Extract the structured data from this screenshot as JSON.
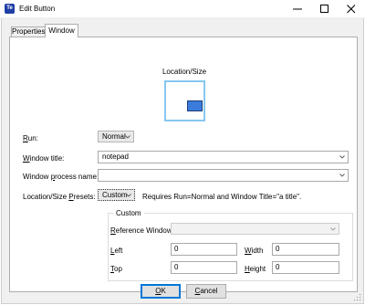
{
  "window": {
    "title": "Edit Button",
    "app_icon_glyph": "Te",
    "controls": [
      "minimize-icon",
      "maximize-icon",
      "close-icon"
    ]
  },
  "tabs": [
    {
      "label": "Properties",
      "active": false
    },
    {
      "label": "Window",
      "active": true
    }
  ],
  "preview": {
    "label": "Location/Size"
  },
  "form": {
    "run": {
      "label_pre": "",
      "label_u": "R",
      "label_post": "un:",
      "value": "Normal"
    },
    "window_title": {
      "label_pre": "",
      "label_u": "W",
      "label_post": "indow title:",
      "value": "notepad"
    },
    "process_name": {
      "label_pre": "Window ",
      "label_u": "p",
      "label_post": "rocess name:",
      "value": ""
    },
    "presets": {
      "label_pre": "Location/Size ",
      "label_u": "P",
      "label_post": "resets:",
      "value": "Custom",
      "note": "Requires Run=Normal and Window Title=\"a title\"."
    }
  },
  "custom": {
    "title": "Custom",
    "reference_window": {
      "label_pre": "",
      "label_u": "R",
      "label_post": "eference Window:",
      "value": ""
    },
    "left": {
      "label_pre": "",
      "label_u": "L",
      "label_post": "eft",
      "value": "0"
    },
    "width": {
      "label_pre": "",
      "label_u": "W",
      "label_post": "idth",
      "value": "0"
    },
    "top": {
      "label_pre": "",
      "label_u": "T",
      "label_post": "op",
      "value": "0"
    },
    "height": {
      "label_pre": "",
      "label_u": "H",
      "label_post": "eight",
      "value": "0"
    }
  },
  "buttons": {
    "ok": {
      "label_u": "O",
      "label_post": "K"
    },
    "cancel": {
      "label_u": "C",
      "label_post": "ancel"
    }
  },
  "colors": {
    "accent": "#0078d7",
    "preview_border": "#87c7f0",
    "preview_window": "#3a7bdc"
  }
}
